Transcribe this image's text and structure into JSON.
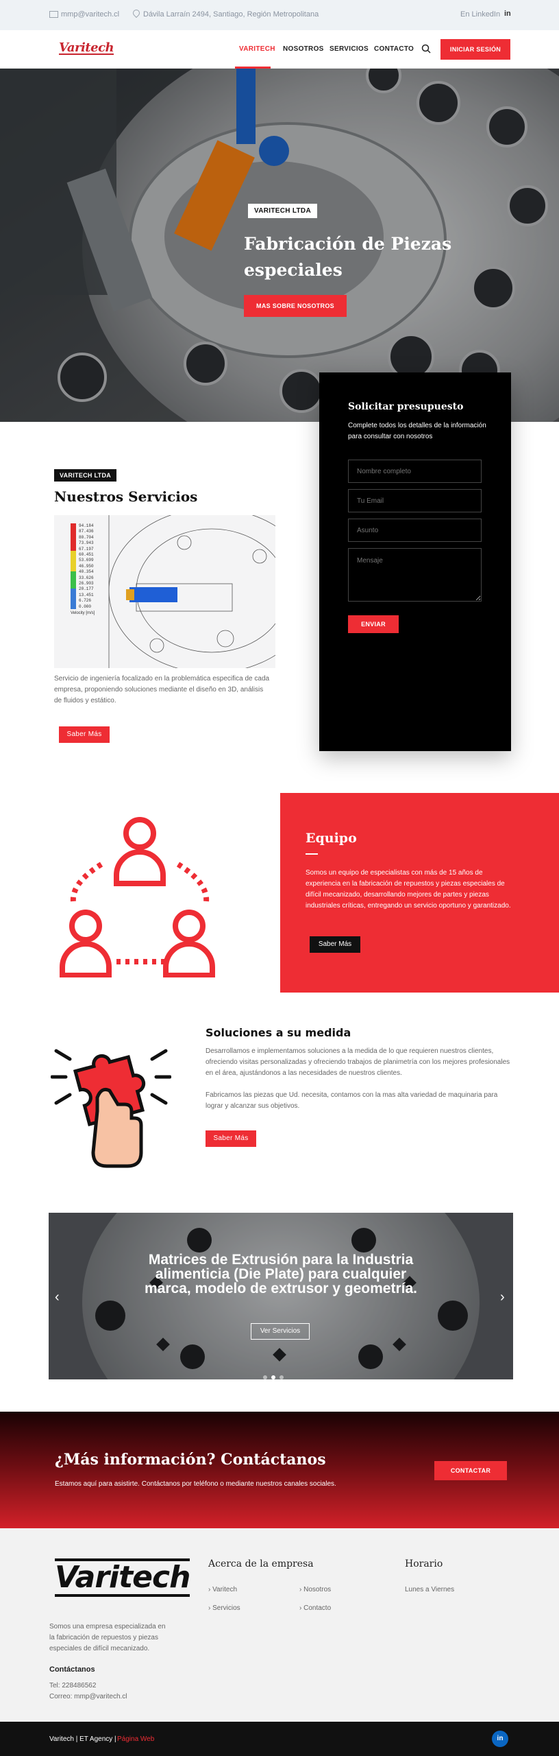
{
  "topbar": {
    "email": "mmp@varitech.cl",
    "address": "Dávila Larraín 2494, Santiago, Región Metropolitana",
    "linkedin_label": "En LinkedIn",
    "linkedin_glyph": "in"
  },
  "header": {
    "logo_text": "Varitech",
    "nav": [
      "VARITECH",
      "NOSOTROS",
      "SERVICIOS",
      "CONTACTO"
    ],
    "login_label": "INICIAR SESIÓN"
  },
  "hero": {
    "tag": "VARITECH LTDA",
    "title": "Fabricación de Piezas especiales",
    "button": "MAS SOBRE NOSOTROS"
  },
  "services": {
    "tag": "VARITECH LTDA",
    "title": "Nuestros Servicios",
    "legend_values": [
      "94.184",
      "87.436",
      "80.704",
      "73.943",
      "67.197",
      "60.451",
      "53.699",
      "46.950",
      "40.354",
      "33.626",
      "26.903",
      "20.177",
      "13.451",
      "6.726",
      "0.000"
    ],
    "legend_label": "Velocity [m/s]",
    "description": "Servicio de ingeniería focalizado en la problemática especifica de cada empresa, proponiendo soluciones mediante el diseño en 3D, análisis de fluidos y estático.",
    "button": "Saber Más"
  },
  "quote": {
    "title": "Solicitar presupuesto",
    "subtitle": "Complete todos los detalles de la información para consultar con nosotros",
    "name_placeholder": "Nombre completo",
    "email_placeholder": "Tu Email",
    "subject_placeholder": "Asunto",
    "message_placeholder": "Mensaje",
    "submit": "ENVIAR"
  },
  "equipo": {
    "title": "Equipo",
    "text": "Somos un equipo de especialistas con más de 15 años de experiencia en la fabricación de repuestos y piezas especiales de difícil mecanizado, desarrollando mejores de partes y piezas industriales críticas, entregando un servicio oportuno y garantizado.",
    "button": "Saber Más"
  },
  "soluciones": {
    "title": "Soluciones a su medida",
    "p1": "Desarrollamos e implementamos soluciones a la medida de lo que requieren nuestros clientes, ofreciendo visitas personalizadas y ofreciendo trabajos de planimetría con los mejores profesionales en el área, ajustándonos a las necesidades de nuestros clientes.",
    "p2": "Fabricamos las piezas que Ud. necesita, contamos con la mas alta variedad de maquinaria para lograr y alcanzar sus objetivos.",
    "button": "Saber Más"
  },
  "slider": {
    "title": "Matrices de Extrusión para la Industria alimenticia (Die Plate) para cualquier marca, modelo de extrusor y geometría.",
    "button": "Ver Servicios",
    "active_slide": 2,
    "slide_count": 3
  },
  "cta": {
    "title": "¿Más información? Contáctanos",
    "subtitle": "Estamos aquí para asistirte. Contáctanos por teléfono o mediante nuestros canales sociales.",
    "button": "CONTACTAR"
  },
  "footer": {
    "logo_text": "Varitech",
    "about": "Somos una empresa especializada en la fabricación de repuestos y piezas especiales de difícil mecanizado.",
    "contact_title": "Contáctanos",
    "phone": "Tel: 228486562",
    "email": "Correo: mmp@varitech.cl",
    "company_title": "Acerca de la empresa",
    "links": [
      "Varitech",
      "Nosotros",
      "Servicios",
      "Contacto"
    ],
    "hours_title": "Horario",
    "hours": "Lunes a Viernes"
  },
  "bottom": {
    "left": "Varitech | ET Agency |",
    "link": "Página Web",
    "linkedin_glyph": "in"
  },
  "colors": {
    "accent": "#ee2d34",
    "dark": "#111111",
    "topbar": "#eef2f5"
  }
}
